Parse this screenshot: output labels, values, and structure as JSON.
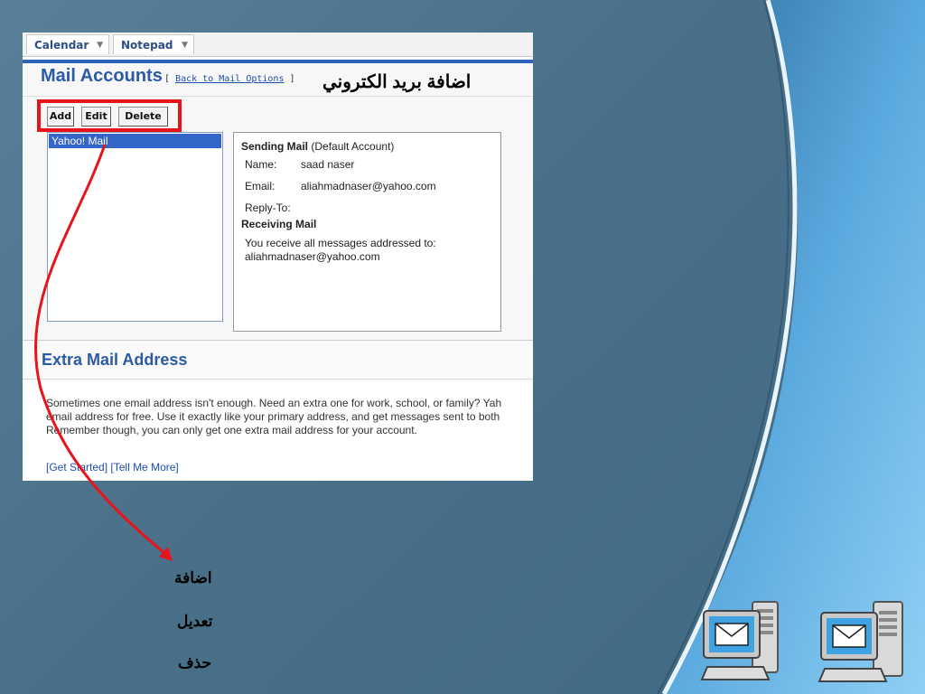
{
  "toolbar": {
    "tabs": [
      {
        "label": "Calendar"
      },
      {
        "label": "Notepad"
      }
    ]
  },
  "header": {
    "title": "Mail Accounts",
    "back_link_prefix": "[",
    "back_link_label": "Back to Mail Options",
    "back_link_suffix": "]",
    "arabic_title": "اضافة بريد الكتروني"
  },
  "actions": {
    "add_label": "Add",
    "edit_label": "Edit",
    "delete_label": "Delete"
  },
  "accounts": {
    "items": [
      {
        "label": "Yahoo! Mail",
        "selected": true
      }
    ]
  },
  "details": {
    "sending_heading": "Sending Mail",
    "sending_note": "(Default Account)",
    "name_label": "Name:",
    "name_value": "saad naser",
    "email_label": "Email:",
    "email_value": "aliahmadnaser@yahoo.com",
    "replyto_label": "Reply-To:",
    "receiving_heading": "Receiving Mail",
    "receiving_line1": "You receive all messages addressed to:",
    "receiving_line2": "aliahmadnaser@yahoo.com"
  },
  "extra": {
    "title": "Extra Mail Address",
    "line1": "Sometimes one email address isn't enough. Need an extra one for work, school, or family? Yah",
    "line2": "email address for free. Use it exactly like your primary address, and get messages sent to both",
    "line3": "Remember though, you can only get one extra mail address for your account.",
    "link_get_started": "[Get Started]",
    "link_tell_more": "[Tell Me More]"
  },
  "annotations": {
    "add": "اضافة",
    "edit": "تعديل",
    "delete": "حذف"
  },
  "colors": {
    "highlight_box": "#e8141b",
    "arrow": "#e8141b",
    "link_blue": "#2c5ba6",
    "selection": "#3465c9"
  },
  "icons": [
    "mail-computer-icon",
    "mail-computer-icon"
  ]
}
